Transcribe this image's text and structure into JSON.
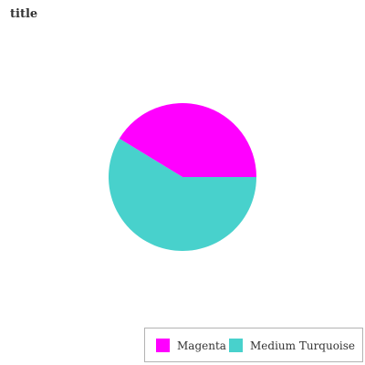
{
  "chart_data": {
    "type": "pie",
    "title": "title",
    "categories": [
      "Magenta",
      "Medium Turquoise"
    ],
    "values": [
      41.3,
      58.7
    ],
    "colors": [
      "#ff00ff",
      "#48d1cc"
    ],
    "legend_position": "bottom-right"
  }
}
